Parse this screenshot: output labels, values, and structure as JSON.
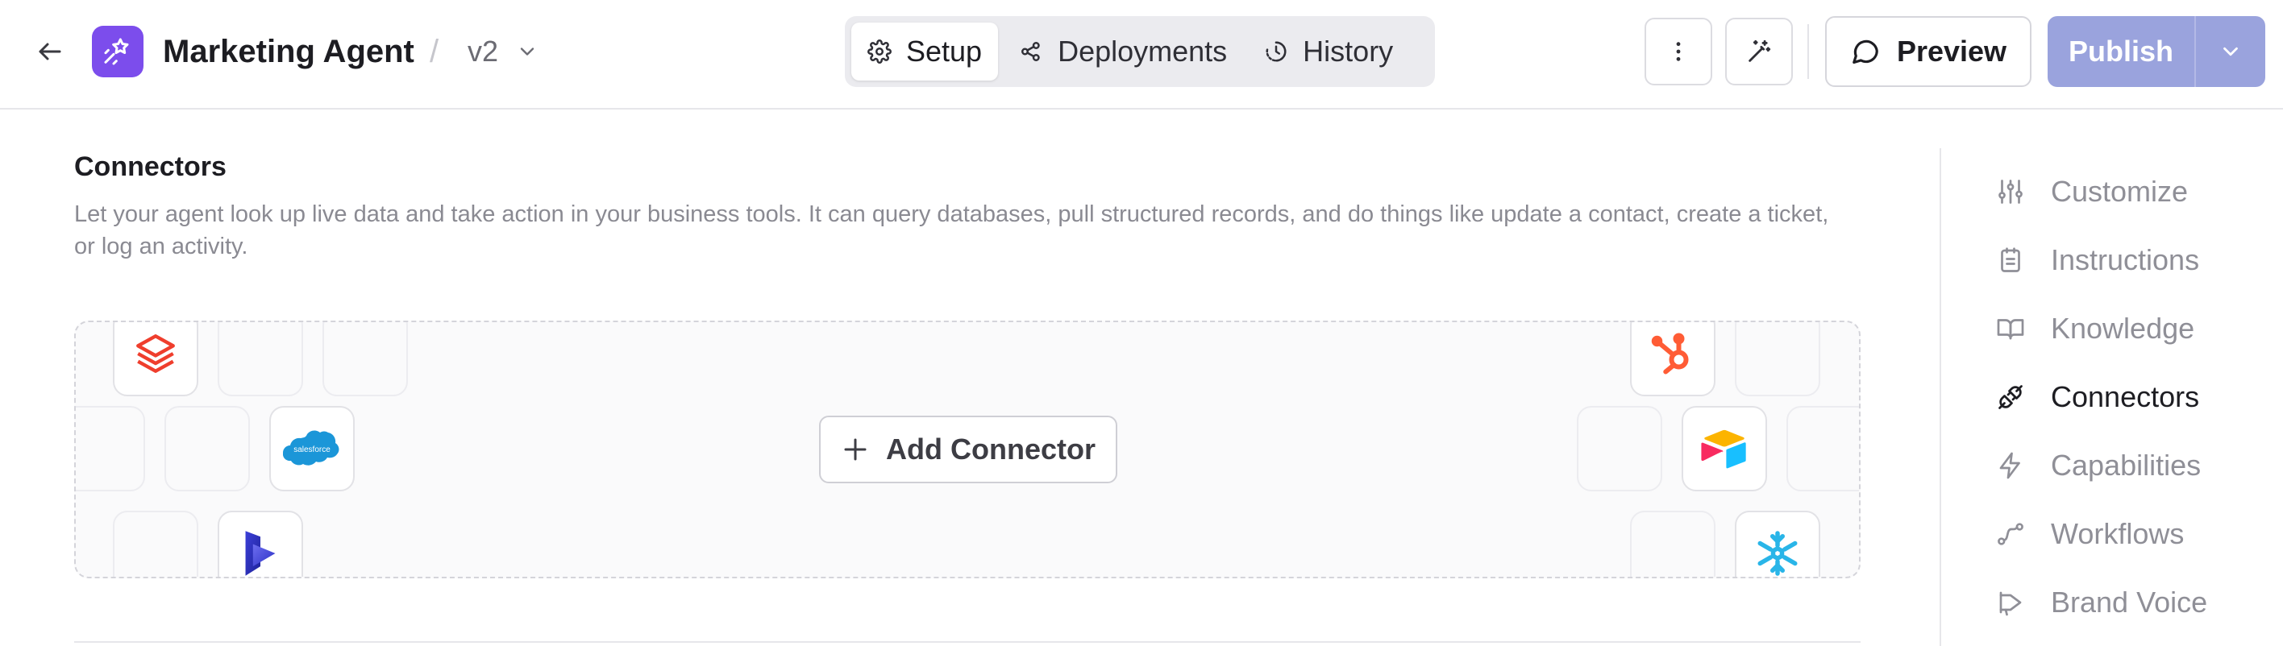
{
  "header": {
    "app_title": "Marketing Agent",
    "separator": "/",
    "version": "v2",
    "tabs": [
      {
        "label": "Setup",
        "icon": "gear-icon",
        "active": true
      },
      {
        "label": "Deployments",
        "icon": "share-nodes-icon",
        "active": false
      },
      {
        "label": "History",
        "icon": "history-clock-icon",
        "active": false
      }
    ],
    "preview_label": "Preview",
    "publish_label": "Publish"
  },
  "colors": {
    "brand_purple": "#7c4dec",
    "publish_disabled": "#9aa3dd",
    "muted_text": "#8a8a92"
  },
  "connectors": {
    "title": "Connectors",
    "description": "Let your agent look up live data and take action in your business tools. It can query databases, pull structured records, and do things like update a contact, create a ticket, or log an activity.",
    "add_label": "Add Connector",
    "logos": {
      "salesforce": "salesforce"
    },
    "logo_icons": [
      "databricks-icon",
      "salesforce-icon",
      "dynamics-icon",
      "hubspot-icon",
      "airtable-icon",
      "snowflake-icon"
    ]
  },
  "sidebar": {
    "items": [
      {
        "label": "Customize",
        "icon": "sliders-icon",
        "active": false
      },
      {
        "label": "Instructions",
        "icon": "clipboard-icon",
        "active": false
      },
      {
        "label": "Knowledge",
        "icon": "book-icon",
        "active": false
      },
      {
        "label": "Connectors",
        "icon": "plug-icon",
        "active": true
      },
      {
        "label": "Capabilities",
        "icon": "lightning-icon",
        "active": false
      },
      {
        "label": "Workflows",
        "icon": "workflow-icon",
        "active": false
      },
      {
        "label": "Brand Voice",
        "icon": "megaphone-icon",
        "active": false
      }
    ]
  }
}
